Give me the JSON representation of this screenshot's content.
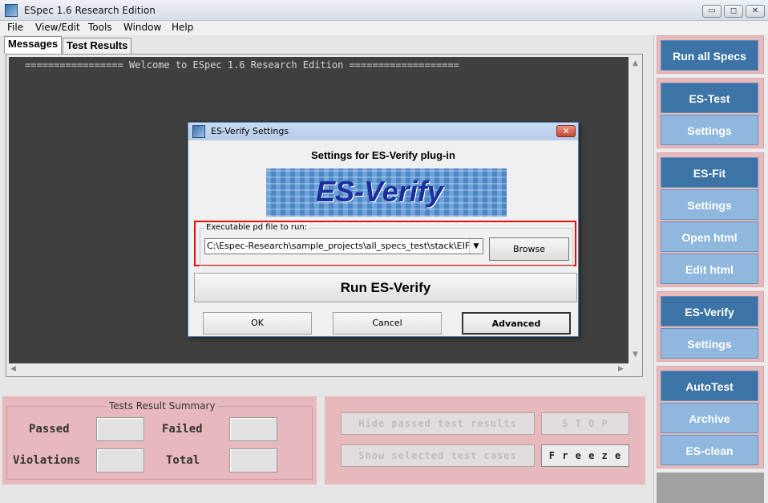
{
  "window": {
    "title": "ESpec 1.6 Research Edition",
    "min": "▭",
    "max": "◻",
    "close": "✕"
  },
  "menu": [
    "File",
    "View/Edit",
    "Tools",
    "Window",
    "Help"
  ],
  "tabs": [
    {
      "label": "Messages",
      "active": true
    },
    {
      "label": "Test Results",
      "active": false
    }
  ],
  "console": {
    "line1": "================= Welcome to ESpec 1.6 Research Edition ==================="
  },
  "dialog": {
    "title": "ES-Verify Settings",
    "heading": "Settings for ES-Verify plug-in",
    "logo_text": "ES-Verify",
    "group_label": "Executable pd file to run:",
    "path_value": "C:\\Espec-Research\\sample_projects\\all_specs_test\\stack\\EIFGENs",
    "browse": "Browse",
    "run": "Run ES-Verify",
    "ok": "OK",
    "cancel": "Cancel",
    "advanced": "Advanced"
  },
  "summary": {
    "title": "Tests Result Summary",
    "passed": "Passed",
    "failed": "Failed",
    "violations": "Violations",
    "total": "Total"
  },
  "controls": {
    "hide_passed": "Hide passed test results",
    "stop": "S T O P",
    "show_selected": "Show selected test cases",
    "freeze": "F r e e z e"
  },
  "right_panel": {
    "run_all": "Run all Specs",
    "es_test": "ES-Test",
    "es_test_settings": "Settings",
    "es_fit": "ES-Fit",
    "es_fit_settings": "Settings",
    "open_html": "Open html",
    "edit_html": "Edit html",
    "es_verify": "ES-Verify",
    "es_verify_settings": "Settings",
    "autotest": "AutoTest",
    "archive": "Archive",
    "es_clean": "ES-clean"
  }
}
